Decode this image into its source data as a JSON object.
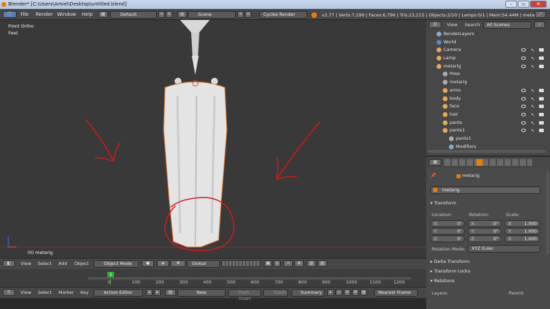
{
  "title": "Blender* [C:\\Users\\Amiel\\Desktop\\untitled.blend]",
  "window_buttons": {
    "min": "–",
    "max": "▭",
    "close": "✕"
  },
  "topmenu": {
    "file": "File",
    "render": "Render",
    "window": "Window",
    "help": "Help"
  },
  "layout": "Default",
  "scene": "Scene",
  "engine": "Cycles Render",
  "stats": "v2.77 | Verts:7,199 | Faces:6,796 | Tris:13,215 | Objects:2/10 | Lamps:0/1 | Mem:54.44M | metarig",
  "viewport": {
    "view_name": "Front Ortho",
    "units": "Feet",
    "object_label": "(0) metarig"
  },
  "viewheader": {
    "view": "View",
    "select": "Select",
    "add": "Add",
    "object": "Object",
    "mode": "Object Mode",
    "orientation": "Global"
  },
  "outliner": {
    "view": "View",
    "search": "Search",
    "filter": "All Scenes",
    "items": [
      {
        "label": "RenderLayers",
        "indent": 1,
        "icon": "#8aa8d8"
      },
      {
        "label": "World",
        "indent": 1,
        "icon": "#5a88c8"
      },
      {
        "label": "Camera",
        "indent": 1,
        "icon": "#e6a85a"
      },
      {
        "label": "Lamp",
        "indent": 1,
        "icon": "#e6a85a"
      },
      {
        "label": "metarig",
        "indent": 1,
        "icon": "#e6a85a"
      },
      {
        "label": "Pose",
        "indent": 2,
        "icon": "#aaaaaa"
      },
      {
        "label": "metarig",
        "indent": 2,
        "icon": "#aaaaaa"
      },
      {
        "label": "arms",
        "indent": 2,
        "icon": "#e6a85a"
      },
      {
        "label": "body",
        "indent": 2,
        "icon": "#e6a85a"
      },
      {
        "label": "face",
        "indent": 2,
        "icon": "#e6a85a"
      },
      {
        "label": "hair",
        "indent": 2,
        "icon": "#e6a85a"
      },
      {
        "label": "pants",
        "indent": 2,
        "icon": "#e6a85a"
      },
      {
        "label": "pants1",
        "indent": 2,
        "icon": "#e6a85a"
      },
      {
        "label": "pants1",
        "indent": 3,
        "icon": "#aaaaaa"
      },
      {
        "label": "Modifiers",
        "indent": 3,
        "icon": "#8aa8d8"
      }
    ]
  },
  "properties": {
    "context": "metarig",
    "object_name": "metarig",
    "transform": "Transform",
    "location": "Location:",
    "rotation": "Rotation:",
    "scale": "Scale:",
    "loc": [
      "X:",
      "0'",
      "Y:",
      "0'",
      "Z:",
      "0'"
    ],
    "rot": [
      "X:",
      "-0°",
      "Y:",
      "0°",
      "Z:",
      "0°"
    ],
    "scl": [
      "X:",
      "1.000",
      "Y:",
      "1.000",
      "Z:",
      "1.000"
    ],
    "rotation_mode_label": "Rotation Mode:",
    "rotation_mode": "XYZ Euler",
    "delta": "Delta Transform",
    "locks": "Transform Locks",
    "relations": "Relations",
    "layers": "Layers:",
    "parent": "Parent:"
  },
  "timeline": {
    "current": "0",
    "ticks": [
      "0",
      "100",
      "200",
      "300",
      "400",
      "500",
      "600",
      "700",
      "800",
      "900",
      "1000",
      "1100",
      "1200"
    ]
  },
  "bottom": {
    "view": "View",
    "select": "Select",
    "marker": "Marker",
    "key": "Key",
    "editor": "Action Editor",
    "new": "New",
    "push_down": "Push Down",
    "stash": "Stash",
    "summary": "Summary",
    "interp": "Nearest Frame"
  },
  "colors": {
    "accent": "#e87d0d",
    "annotation": "#d11a1a"
  }
}
